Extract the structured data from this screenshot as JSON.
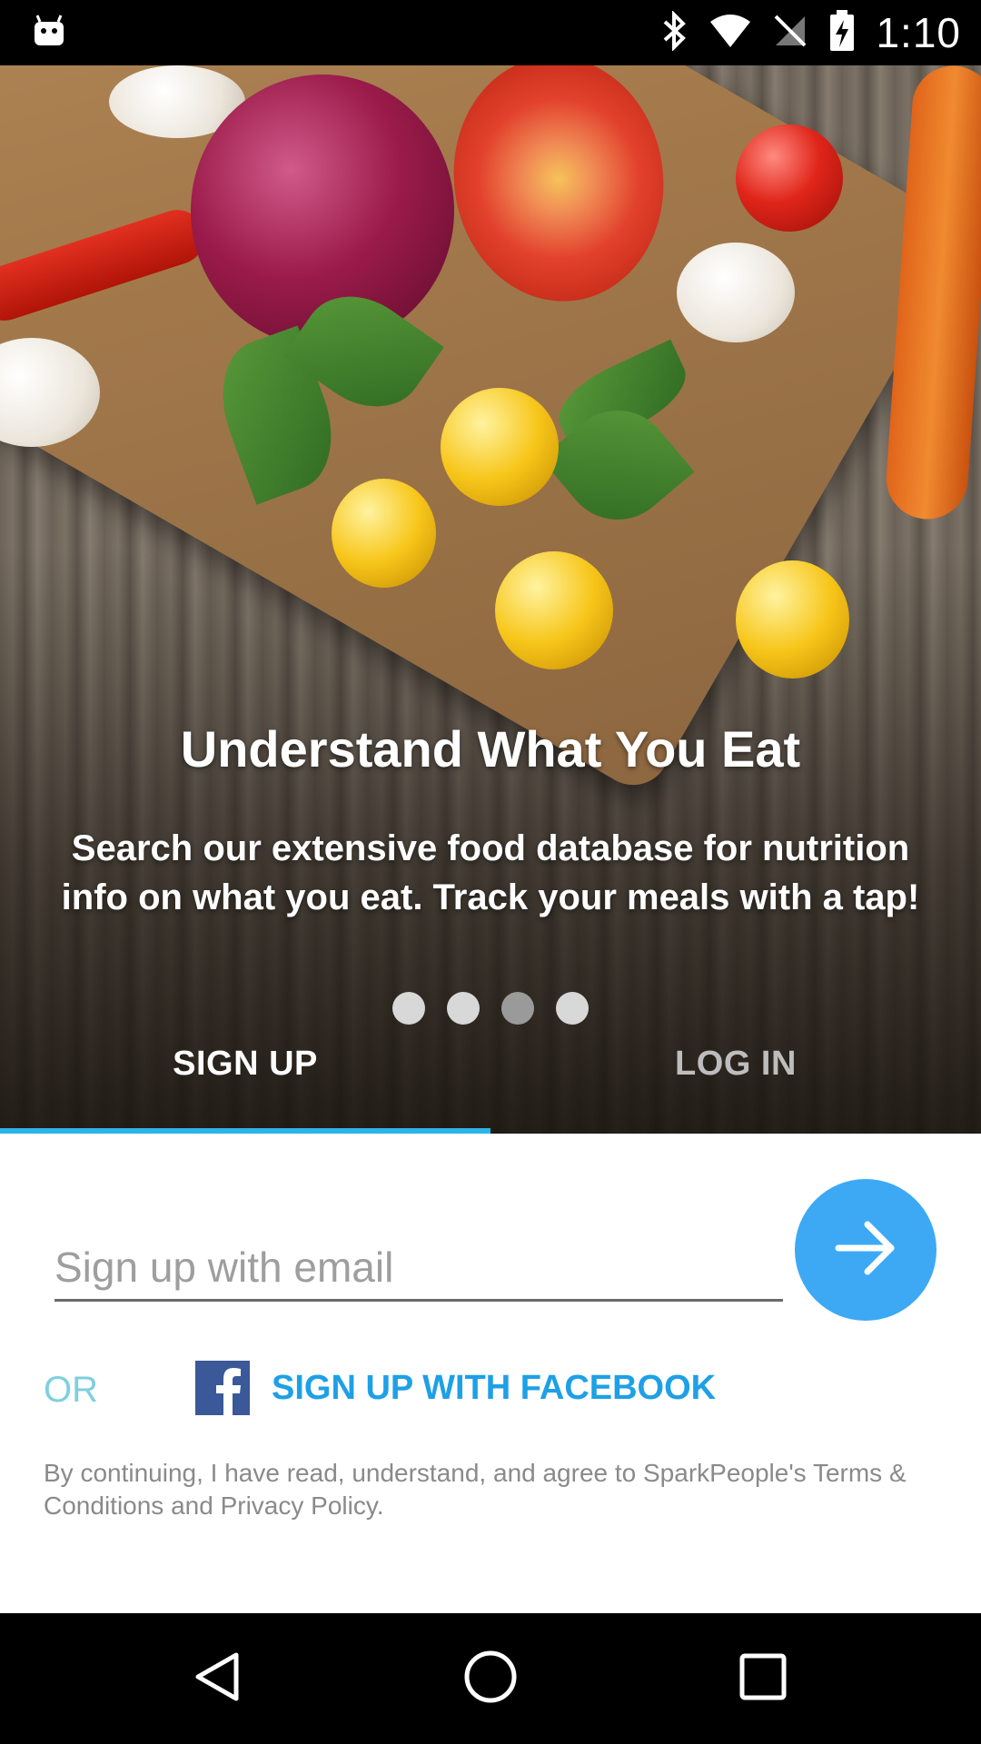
{
  "status_bar": {
    "time": "1:10",
    "icons": [
      "android-icon",
      "bluetooth-icon",
      "wifi-icon",
      "no-sim-icon",
      "battery-charging-icon"
    ]
  },
  "hero": {
    "title": "Understand What You Eat",
    "description": "Search our extensive food database for nutrition info on what you eat.  Track your meals with a tap!",
    "page_indicator": {
      "count": 4,
      "active_index": 2
    }
  },
  "tabs": {
    "signup_label": "SIGN UP",
    "login_label": "LOG IN",
    "selected": "SIGN UP",
    "indicator_color": "#29b6e6"
  },
  "form": {
    "email_placeholder": "Sign up with email",
    "email_value": "",
    "next_button_icon": "arrow-right-icon",
    "next_button_color": "#3da9f4",
    "or_label": "OR",
    "facebook_label": "SIGN UP WITH FACEBOOK",
    "facebook_icon": "facebook-icon",
    "terms": "By continuing, I have read, understand, and agree to SparkPeople's Terms & Conditions and Privacy Policy."
  },
  "nav_bar": {
    "buttons": [
      "back-icon",
      "home-icon",
      "recents-icon"
    ]
  }
}
